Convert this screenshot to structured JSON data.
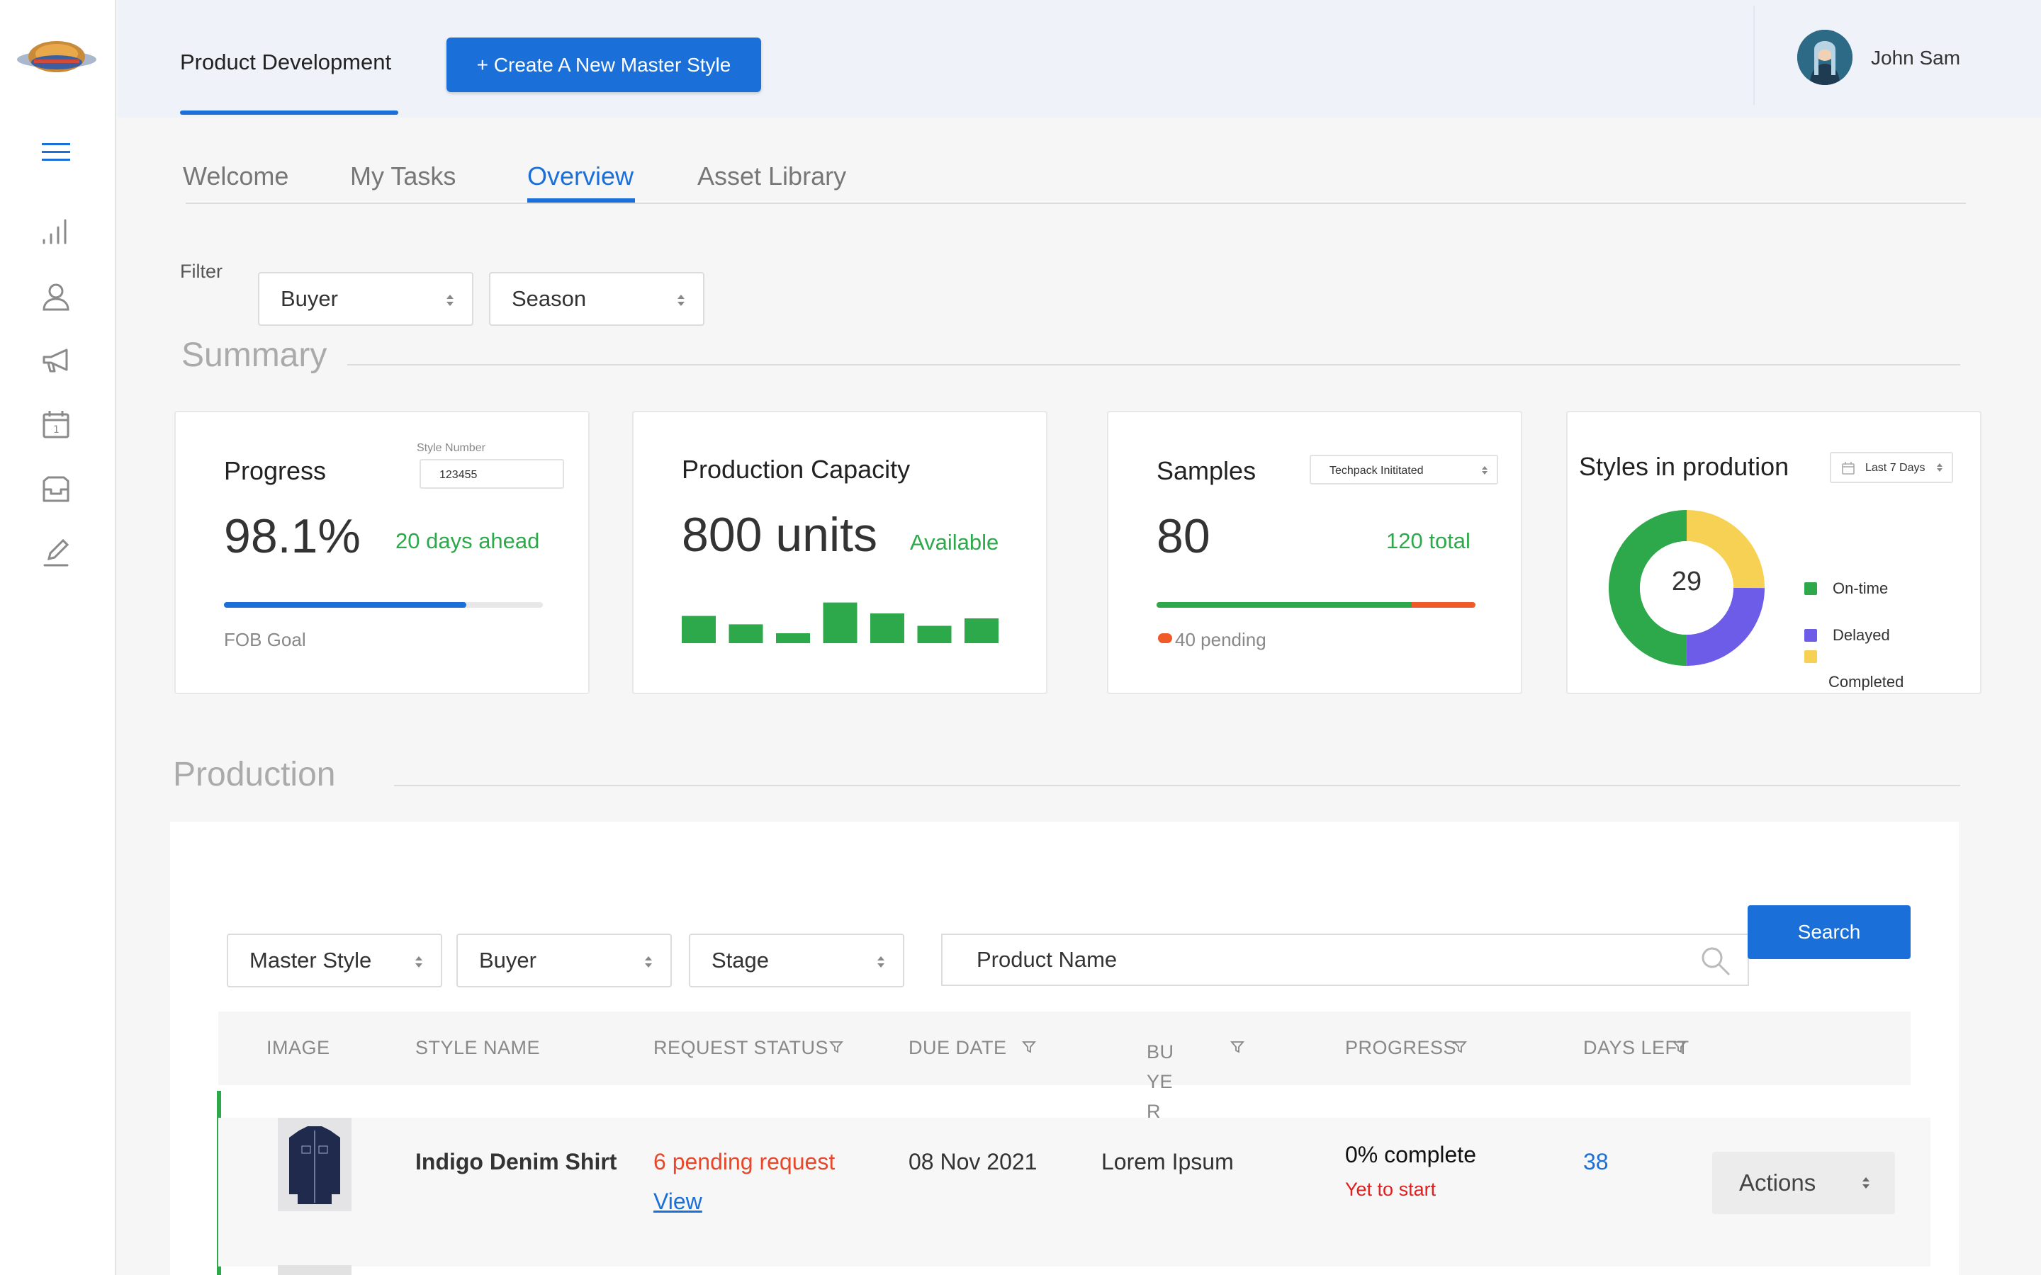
{
  "header": {
    "section_tab": "Product Development",
    "create_button": "+ Create A New Master Style",
    "user_name": "John Sam"
  },
  "tabs": [
    {
      "label": "Welcome"
    },
    {
      "label": "My Tasks"
    },
    {
      "label": "Overview",
      "active": true
    },
    {
      "label": "Asset Library"
    }
  ],
  "filter": {
    "label": "Filter",
    "buyer": "Buyer",
    "season": "Season"
  },
  "summary": {
    "title": "Summary",
    "progress": {
      "title": "Progress",
      "style_number_label": "Style Number",
      "style_number_value": "123455",
      "value": "98.1%",
      "status": "20 days ahead",
      "bar_fraction": 0.76,
      "footer": "FOB Goal"
    },
    "capacity": {
      "title": "Production Capacity",
      "value": "800 units",
      "status": "Available",
      "bars": [
        0.55,
        0.38,
        0.2,
        0.82,
        0.6,
        0.35,
        0.5
      ]
    },
    "samples": {
      "title": "Samples",
      "dropdown": "Techpack Inititated",
      "value": "80",
      "total": "120 total",
      "completed_fraction": 0.8,
      "pending": "40 pending"
    },
    "styles": {
      "title": "Styles in prodution",
      "dropdown": "Last 7 Days",
      "center_value": "29",
      "legend": [
        {
          "label": "On-time",
          "color": "#2da84a",
          "fraction": 0.5
        },
        {
          "label": "Delayed",
          "color": "#6c5ce7",
          "fraction": 0.25
        },
        {
          "label": "Completed",
          "color": "#f7d154",
          "fraction": 0.25
        }
      ]
    }
  },
  "production": {
    "title": "Production",
    "filters": {
      "master_style": "Master Style",
      "buyer": "Buyer",
      "stage": "Stage",
      "search_placeholder": "Product Name",
      "search_button": "Search"
    },
    "columns": {
      "image": "IMAGE",
      "style_name": "STYLE NAME",
      "request_status": "REQUEST STATUS",
      "due_date": "DUE DATE",
      "buyer": "BUYE R",
      "progress": "PROGRESS",
      "days_left": "DAYS LEFT"
    },
    "rows": [
      {
        "style_name": "Indigo Denim Shirt",
        "request_status": "6 pending request",
        "view_link": "View",
        "due_date": "08 Nov 2021",
        "buyer": "Lorem Ipsum",
        "progress": "0% complete",
        "progress_status": "Yet to start",
        "days_left": "38",
        "actions": "Actions"
      }
    ]
  },
  "colors": {
    "accent": "#1a6fd8",
    "green": "#2da84a",
    "red": "#e8472a",
    "orange": "#f05a28"
  }
}
